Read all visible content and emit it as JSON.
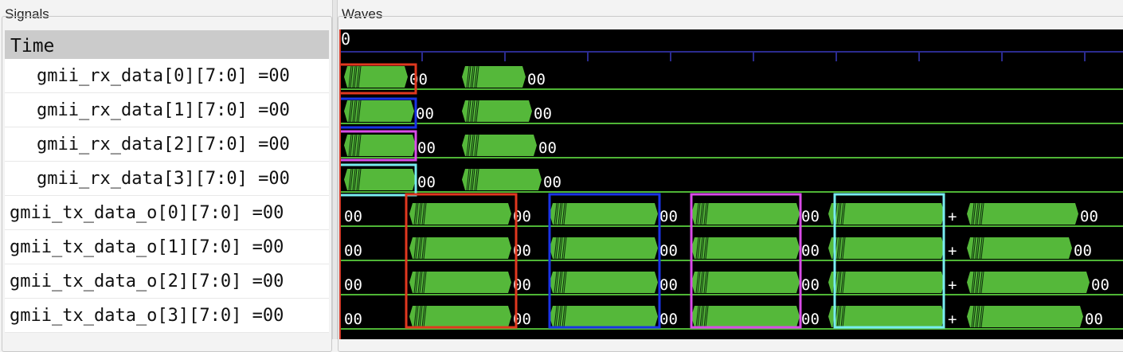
{
  "signals_panel": {
    "title": "Signals",
    "header": "Time"
  },
  "waves_panel": {
    "title": "Waves",
    "time_zero": "0"
  },
  "signals": [
    {
      "name": "gmii_rx_data[0][7:0] =00",
      "indent": true
    },
    {
      "name": "gmii_rx_data[1][7:0] =00",
      "indent": true
    },
    {
      "name": "gmii_rx_data[2][7:0] =00",
      "indent": true
    },
    {
      "name": "gmii_rx_data[3][7:0] =00",
      "indent": true
    },
    {
      "name": "gmii_tx_data_o[0][7:0] =00",
      "indent": false
    },
    {
      "name": "gmii_tx_data_o[1][7:0] =00",
      "indent": false
    },
    {
      "name": "gmii_tx_data_o[2][7:0] =00",
      "indent": false
    },
    {
      "name": "gmii_tx_data_o[3][7:0] =00",
      "indent": false
    }
  ],
  "value_label": "00",
  "plus_label": "+",
  "colors": {
    "wave_fill": "#55b83a",
    "wave_line": "#4fb536",
    "axis": "#2b2b8f",
    "box_red": "#e0381f",
    "box_blue": "#1a33e6",
    "box_magenta": "#d94be8",
    "box_cyan": "#78ecf0"
  }
}
